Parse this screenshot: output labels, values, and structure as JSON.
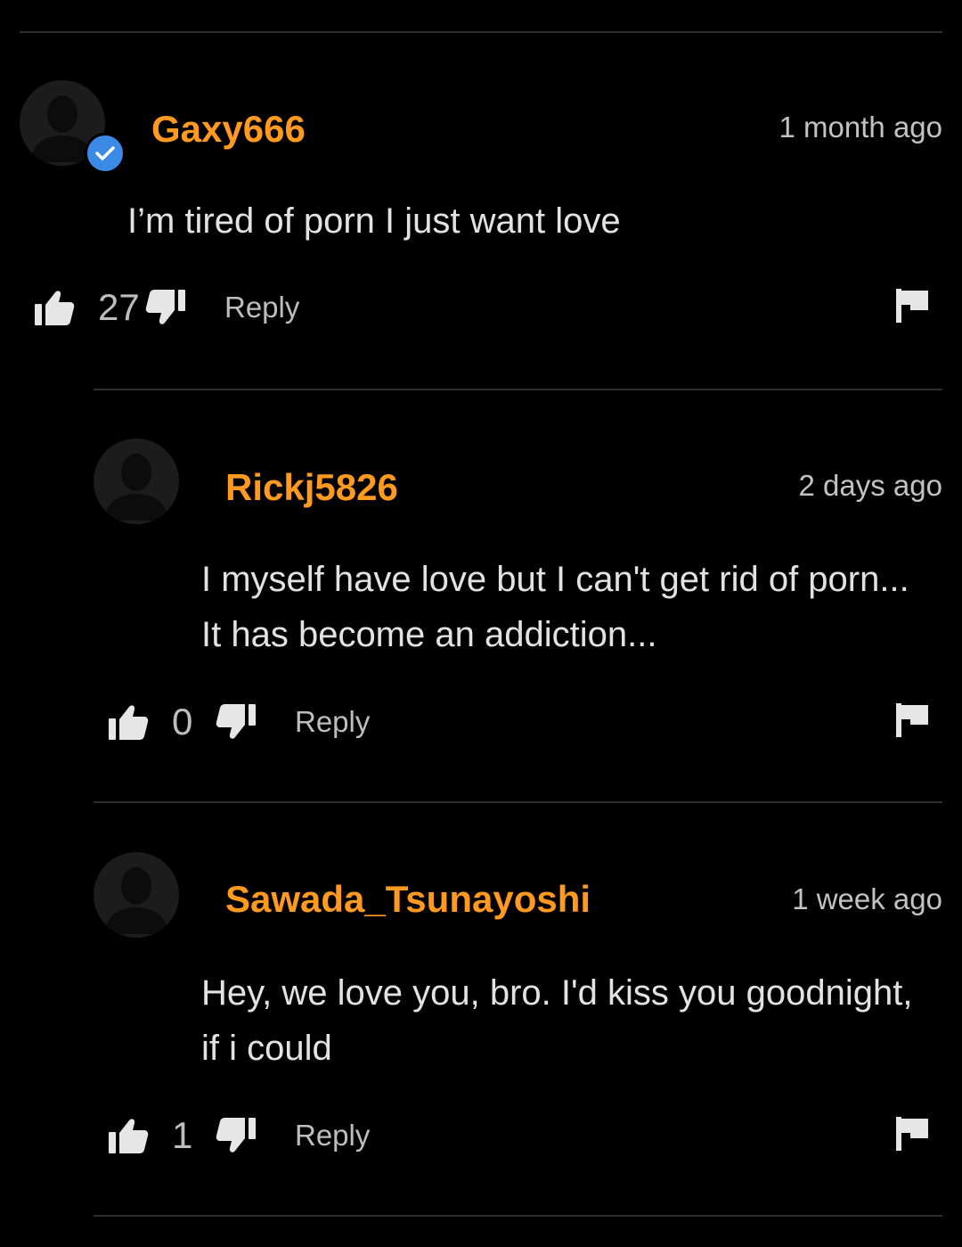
{
  "colors": {
    "background": "#000000",
    "username": "#ff9a1f",
    "verified": "#3b8ae6",
    "divider": "#2e2e2e"
  },
  "comments": [
    {
      "username": "Gaxy666",
      "time": "1 month ago",
      "verified": true,
      "lines": [
        "I’m tired of porn I just want love"
      ],
      "likes": "27",
      "reply_label": "Reply"
    },
    {
      "username": "Rickj5826",
      "time": "2 days ago",
      "verified": false,
      "lines": [
        "I myself have love but I can't get rid of porn...",
        "It has become an addiction..."
      ],
      "likes": "0",
      "reply_label": "Reply"
    },
    {
      "username": "Sawada_Tsunayoshi",
      "time": "1 week ago",
      "verified": false,
      "lines": [
        "Hey, we love you, bro. I'd kiss you goodnight,",
        "if i could"
      ],
      "likes": "1",
      "reply_label": "Reply"
    }
  ],
  "icons": {
    "like": "thumbs-up-icon",
    "dislike": "thumbs-down-icon",
    "flag": "flag-icon",
    "verified": "check-icon",
    "avatar": "default-avatar-icon"
  }
}
